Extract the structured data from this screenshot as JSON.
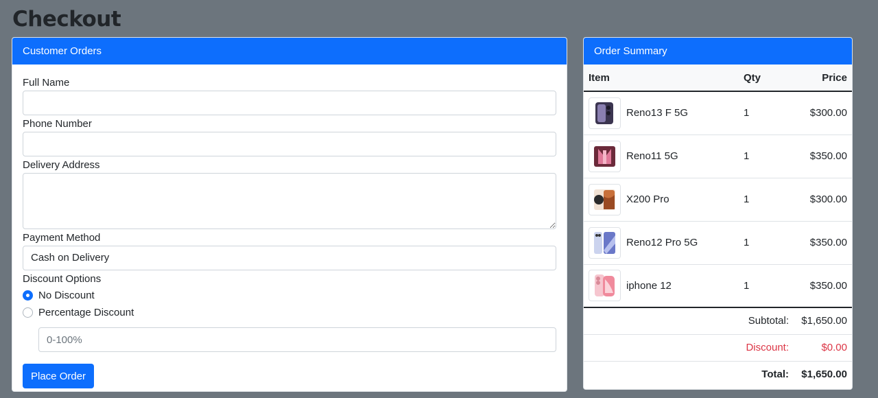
{
  "page": {
    "title": "Checkout"
  },
  "orders": {
    "header": "Customer Orders",
    "fields": {
      "full_name_label": "Full Name",
      "phone_label": "Phone Number",
      "address_label": "Delivery Address",
      "payment_label": "Payment Method",
      "payment_value": "Cash on Delivery",
      "discount_label": "Discount Options",
      "no_discount_label": "No Discount",
      "percentage_discount_label": "Percentage Discount",
      "discount_placeholder": "0-100%"
    },
    "submit_label": "Place Order"
  },
  "summary": {
    "header": "Order Summary",
    "columns": {
      "item": "Item",
      "qty": "Qty",
      "price": "Price"
    },
    "items": [
      {
        "name": "Reno13 F 5G",
        "qty": "1",
        "price": "$300.00",
        "icon": "phone-thumbnail-purple"
      },
      {
        "name": "Reno11 5G",
        "qty": "1",
        "price": "$350.00",
        "icon": "phone-thumbnail-pink"
      },
      {
        "name": "X200 Pro",
        "qty": "1",
        "price": "$300.00",
        "icon": "phone-thumbnail-orange"
      },
      {
        "name": "Reno12 Pro 5G",
        "qty": "1",
        "price": "$350.00",
        "icon": "phone-thumbnail-blue"
      },
      {
        "name": "iphone 12",
        "qty": "1",
        "price": "$350.00",
        "icon": "phone-thumbnail-rose"
      }
    ],
    "subtotal_label": "Subtotal:",
    "subtotal_value": "$1,650.00",
    "discount_label": "Discount:",
    "discount_value": "$0.00",
    "total_label": "Total:",
    "total_value": "$1,650.00"
  },
  "colors": {
    "page_bg": "#6c757d",
    "primary": "#0d6efd",
    "danger": "#dc3545"
  }
}
